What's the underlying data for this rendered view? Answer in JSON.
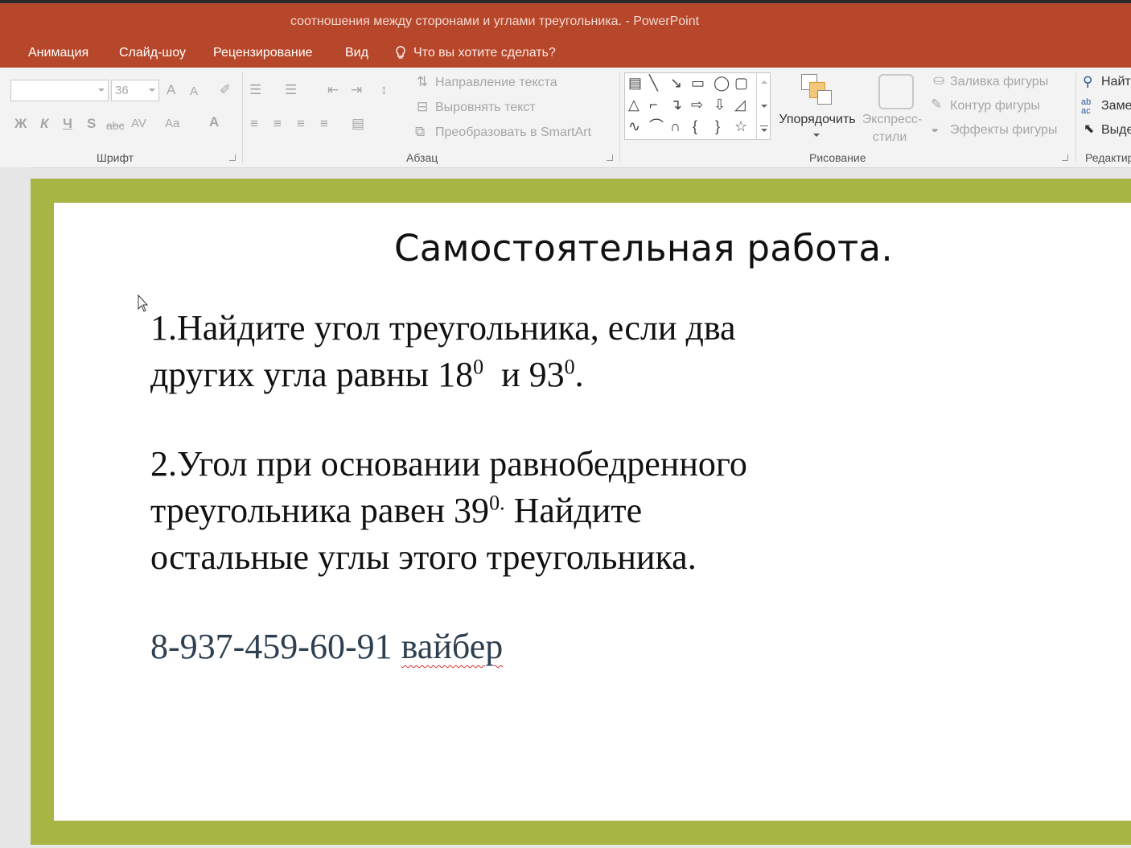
{
  "window": {
    "title": "соотношения между сторонами и углами треугольника. - PowerPoint"
  },
  "ribbon_tabs": [
    {
      "label": "Анимация"
    },
    {
      "label": "Слайд-шоу"
    },
    {
      "label": "Рецензирование"
    },
    {
      "label": "Вид"
    }
  ],
  "tell_me": {
    "label": "Что вы хотите сделать?"
  },
  "font_group": {
    "label": "Шрифт",
    "font_name": "",
    "font_size": "36",
    "bold": "Ж",
    "italic": "К",
    "underline": "Ч",
    "shadow": "S",
    "strike": "abc",
    "spacing": "AV",
    "case": "Aa",
    "font_color": "A",
    "grow": "A",
    "shrink": "A"
  },
  "paragraph_group": {
    "label": "Абзац",
    "text_direction": "Направление текста",
    "align_text": "Выровнять текст",
    "convert_smartart": "Преобразовать в SmartArt"
  },
  "drawing_group": {
    "label": "Рисование",
    "arrange": "Упорядочить",
    "quick_styles_1": "Экспресс-",
    "quick_styles_2": "стили",
    "shape_fill": "Заливка фигуры",
    "shape_outline": "Контур фигуры",
    "shape_effects": "Эффекты фигуры"
  },
  "editing_group": {
    "label": "Редактир",
    "find": "Найт",
    "replace": "Заме",
    "select": "Выде"
  },
  "slide": {
    "title": "Самостоятельная работа.",
    "task1_line1": "1.Найдите угол треугольника, если два",
    "task1_line2_a": "других угла равны 18",
    "task1_line2_sup1": "0",
    "task1_line2_b": "  и 93",
    "task1_line2_sup2": "0",
    "task1_line2_c": ".",
    "task2_line1": "2.Угол при основании равнобедренного",
    "task2_line2_a": "треугольника равен 39",
    "task2_line2_sup": "0.",
    "task2_line2_b": " Найдите",
    "task2_line3": "остальные углы этого треугольника.",
    "phone": "8-937-459-60-91",
    "viber": "вайбер"
  },
  "colors": {
    "title_bar": "#b7472a",
    "slide_border": "#a7b545",
    "ribbon_bg": "#f3f3f3",
    "phone_text": "#2e3f4f"
  }
}
